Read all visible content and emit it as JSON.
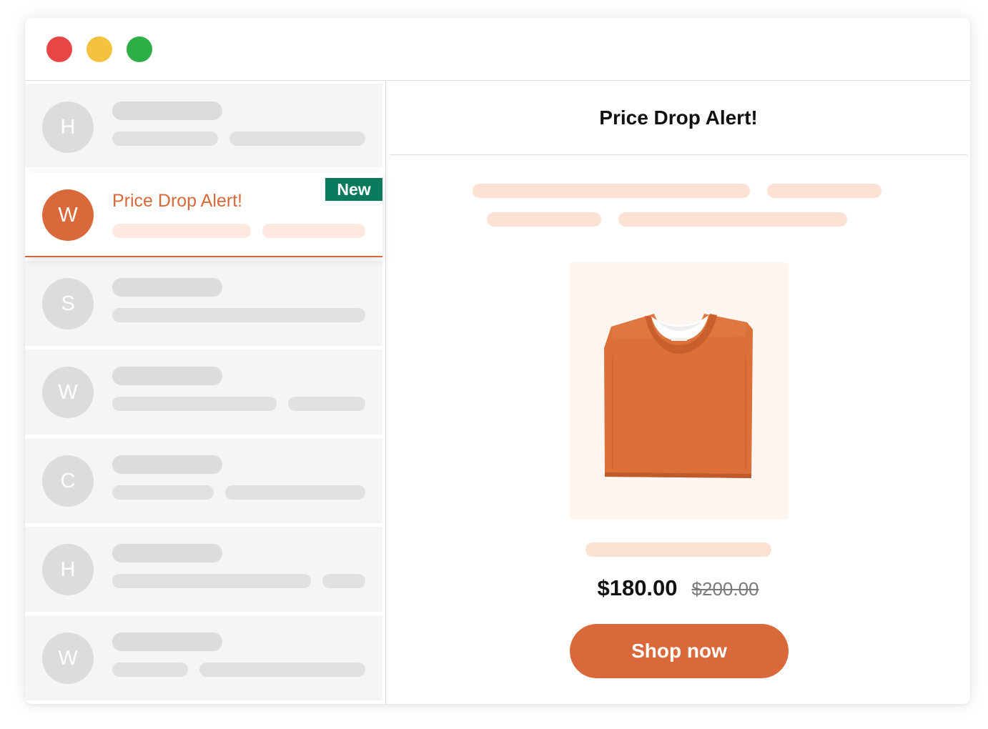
{
  "window": {
    "controls": [
      {
        "name": "close",
        "color": "#e84545"
      },
      {
        "name": "minimize",
        "color": "#f5c240"
      },
      {
        "name": "maximize",
        "color": "#2dae47"
      }
    ]
  },
  "inbox": {
    "items": [
      {
        "avatar": "H",
        "active": false
      },
      {
        "avatar": "W",
        "active": true,
        "subject": "Price Drop Alert!",
        "badge": "New"
      },
      {
        "avatar": "S",
        "active": false
      },
      {
        "avatar": "W",
        "active": false
      },
      {
        "avatar": "C",
        "active": false
      },
      {
        "avatar": "H",
        "active": false
      },
      {
        "avatar": "W",
        "active": false
      }
    ]
  },
  "email": {
    "title": "Price Drop Alert!",
    "product_image": "orange-tshirt",
    "price": "$180.00",
    "original_price": "$200.00",
    "cta": "Shop now"
  },
  "colors": {
    "accent": "#d9693a",
    "badge": "#0a7a5c",
    "placeholder": "#e1e1e1",
    "placeholder_accent": "#fde1d3"
  }
}
